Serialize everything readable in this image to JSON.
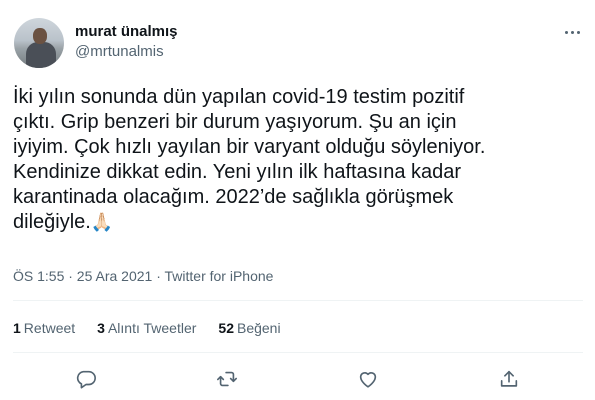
{
  "author": {
    "name": "murat ünalmış",
    "handle": "@mrtunalmis"
  },
  "tweet": {
    "text": "İki yılın sonunda dün yapılan covid-19 testim pozitif\nçıktı. Grip benzeri bir durum yaşıyorum. Şu an için\niyiyim. Çok hızlı yayılan bir varyant olduğu söyleniyor.\nKendinize dikkat edin. Yeni yılın ilk haftasına kadar\nkarantinada olacağım. 2022’de sağlıkla görüşmek\ndileğiyle.",
    "emoji": "🙏🏻"
  },
  "meta": "ÖS 1:55 · 25 Ara 2021 · Twitter for iPhone",
  "stats": {
    "retweets_count": "1",
    "retweets_label": "Retweet",
    "quotes_count": "3",
    "quotes_label": "Alıntı Tweetler",
    "likes_count": "52",
    "likes_label": "Beğeni"
  },
  "icons": {
    "more": "more-icon",
    "reply": "reply-icon",
    "retweet": "retweet-icon",
    "like": "like-icon",
    "share": "share-icon"
  },
  "colors": {
    "text": "#0f1419",
    "secondary": "#536471",
    "divider": "#eff3f4"
  }
}
